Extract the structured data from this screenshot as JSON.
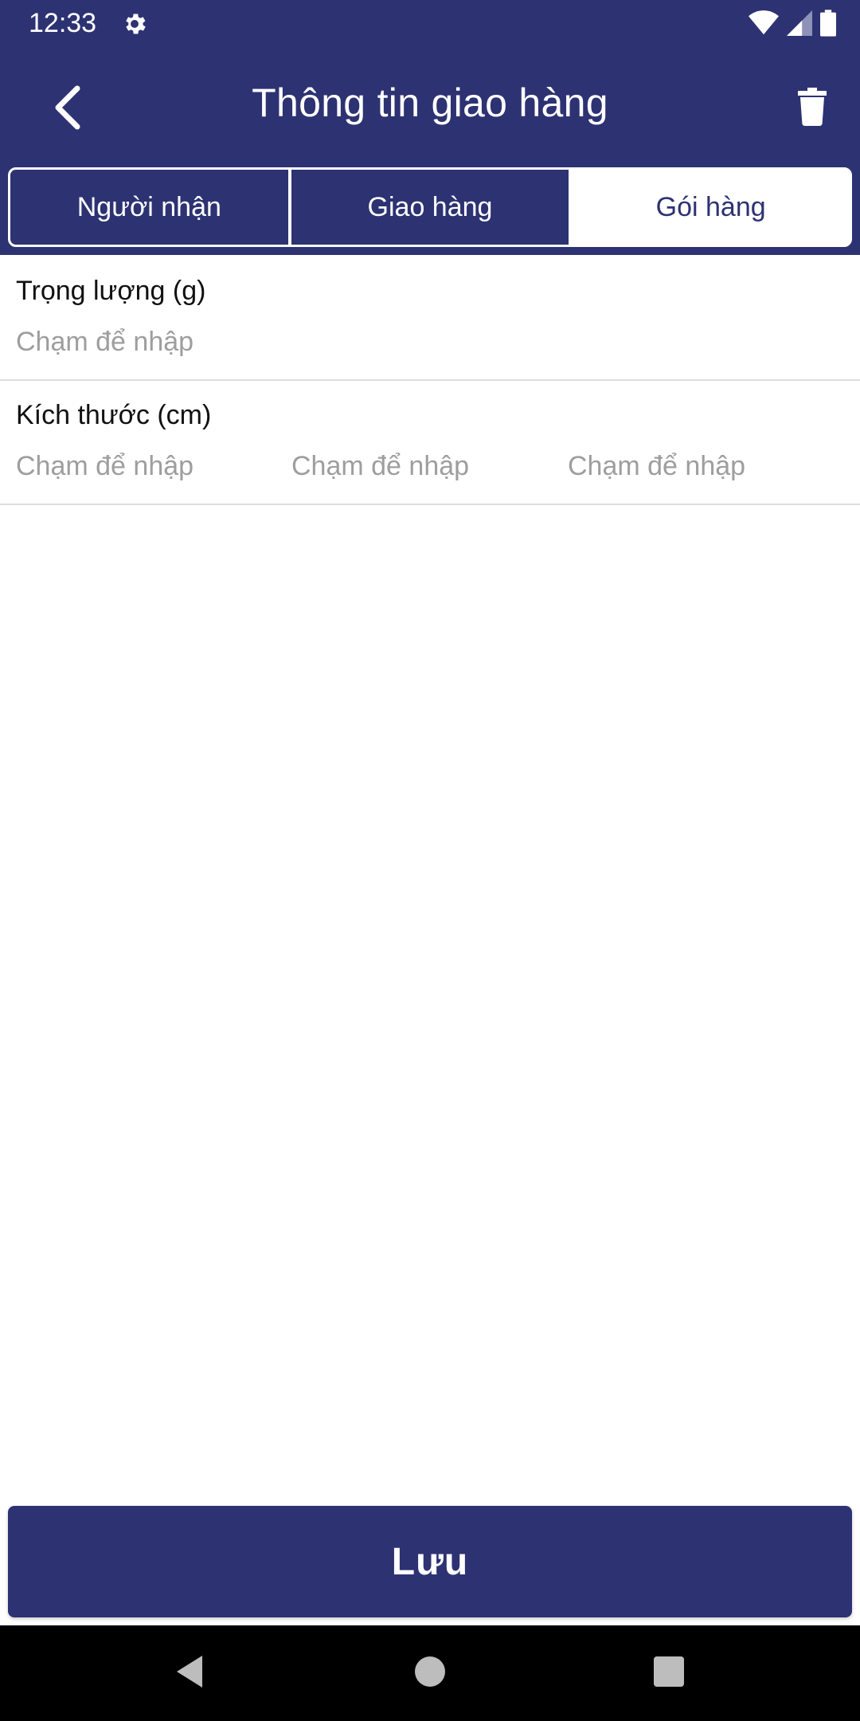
{
  "status_bar": {
    "time": "12:33",
    "icons": [
      "gear-icon",
      "wifi-icon",
      "signal-icon",
      "battery-icon"
    ]
  },
  "app_bar": {
    "title": "Thông tin giao hàng",
    "back_icon": "chevron-left-icon",
    "delete_icon": "trash-icon"
  },
  "tabs": [
    {
      "label": "Người nhận",
      "active": false
    },
    {
      "label": "Giao hàng",
      "active": false
    },
    {
      "label": "Gói hàng",
      "active": true
    }
  ],
  "form": {
    "weight": {
      "label": "Trọng lượng (g)",
      "placeholder": "Chạm để nhập"
    },
    "size": {
      "label": "Kích thước (cm)",
      "length_placeholder": "Chạm để nhập",
      "width_placeholder": "Chạm để nhập",
      "height_placeholder": "Chạm để nhập"
    }
  },
  "save_button": {
    "label": "Lưu"
  },
  "nav_bar": {
    "icons": [
      "back-triangle-icon",
      "home-circle-icon",
      "recents-square-icon"
    ]
  },
  "colors": {
    "primary": "#2d3272",
    "placeholder": "#9e9e9e",
    "divider": "#dddddd"
  }
}
